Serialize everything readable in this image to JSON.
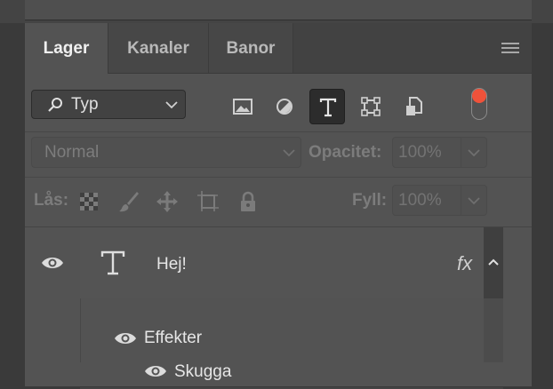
{
  "tabs": [
    {
      "label": "Lager",
      "active": true
    },
    {
      "label": "Kanaler",
      "active": false
    },
    {
      "label": "Banor",
      "active": false
    }
  ],
  "filter": {
    "label": "Typ"
  },
  "filter_icons": [
    "image-filter-icon",
    "adjustment-filter-icon",
    "type-filter-icon",
    "shape-filter-icon",
    "smart-object-filter-icon"
  ],
  "filter_toggle_color": "#f0523a",
  "blend": {
    "mode": "Normal",
    "opacity_label": "Opacitet:",
    "opacity_value": "100%"
  },
  "lock": {
    "label": "Lås:",
    "fill_label": "Fyll:",
    "fill_value": "100%"
  },
  "layer": {
    "name": "Hej!",
    "fx_label": "fx",
    "effects_label": "Effekter",
    "effect_name": "Skugga"
  }
}
